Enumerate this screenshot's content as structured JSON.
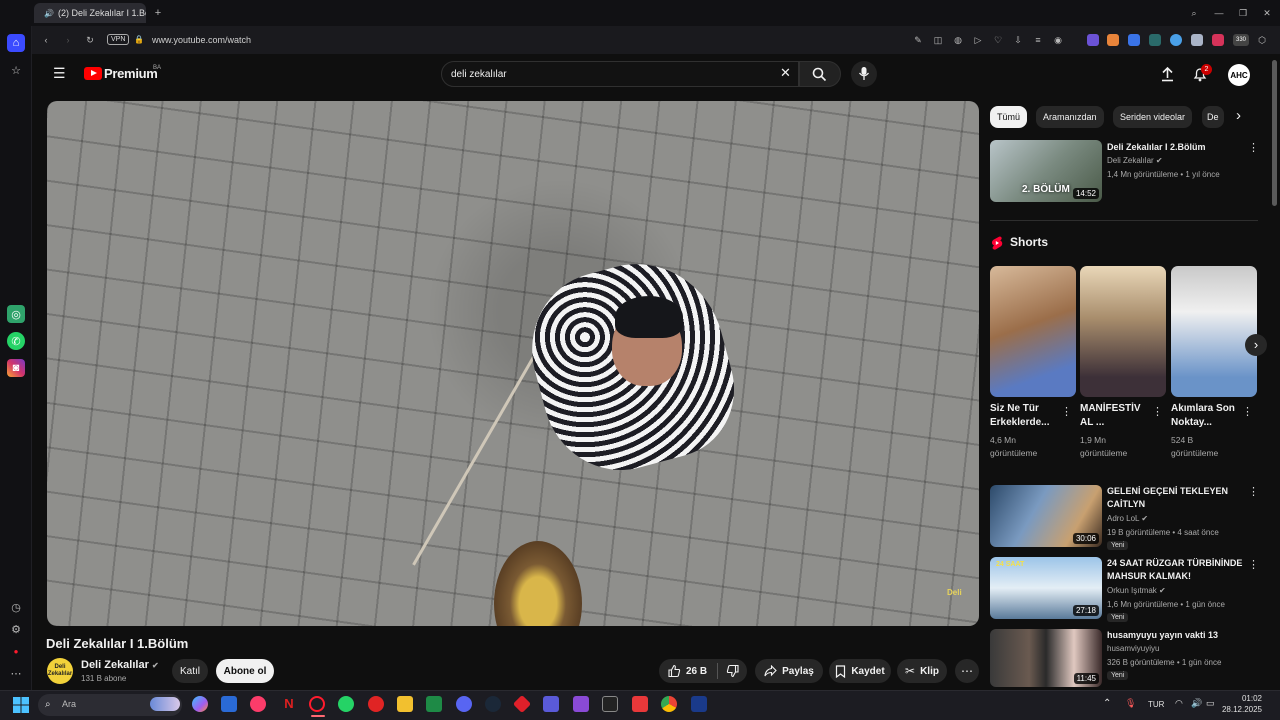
{
  "browser": {
    "tab_title": "(2) Deli Zekalılar I 1.Bölü",
    "url": "www.youtube.com/watch",
    "vpn_label": "VPN",
    "ext_badge": "330"
  },
  "yt": {
    "logo_text": "Premium",
    "region": "BA",
    "search_value": "deli zekalılar",
    "notif_count": "2",
    "avatar_initials": "AHC"
  },
  "video": {
    "title": "Deli Zekalılar I 1.Bölüm",
    "watermark": "Deli",
    "channel": {
      "name": "Deli Zekalılar",
      "subs": "131 B abone",
      "avatar_text": "Deli Zekalılar"
    },
    "actions": {
      "join": "Katıl",
      "subscribe": "Abone ol",
      "likes": "26 B",
      "share": "Paylaş",
      "save": "Kaydet",
      "clip": "Klip"
    }
  },
  "chips": [
    "Tümü",
    "Aramanızdan",
    "Seriden videolar",
    "De"
  ],
  "related_top": {
    "title": "Deli Zekalılar I 2.Bölüm",
    "channel": "Deli Zekalılar",
    "meta": "1,4 Mn görüntüleme • 1 yıl önce",
    "duration": "14:52",
    "thumb_text": "2. BÖLÜM"
  },
  "shorts": {
    "heading": "Shorts",
    "items": [
      {
        "title": "Siz Ne Tür Erkeklerde...",
        "views": "4,6 Mn görüntüleme"
      },
      {
        "title": "MANİFESTİV AL ...",
        "views": "1,9 Mn görüntüleme"
      },
      {
        "title": "Akımlara Son Noktay...",
        "views": "524 B görüntüleme"
      }
    ]
  },
  "related": [
    {
      "title": "GELENİ GEÇENİ TEKLEYEN CAİTLYN",
      "channel": "Adro LoL",
      "meta": "19 B görüntüleme • 4 saat önce",
      "badge": "Yeni",
      "duration": "30:06"
    },
    {
      "title": "24 SAAT RÜZGAR TÜRBİNİNDE MAHSUR KALMAK!",
      "channel": "Orkun Işıtmak",
      "meta": "1,6 Mn görüntüleme • 1 gün önce",
      "badge": "Yeni",
      "duration": "27:18",
      "thumb_text": "24 SAAT"
    },
    {
      "title": "husamyuyu yayın vakti 13",
      "channel": "husamviyuyiyu",
      "meta": "326 B görüntüleme • 1 gün önce",
      "badge": "Yeni",
      "duration": "11:45"
    }
  ],
  "taskbar": {
    "search_placeholder": "Ara",
    "lang": "TUR",
    "time": "01:02",
    "date": "28.12.2025"
  },
  "colors": {
    "yt_red": "#ff0000",
    "background": "#0f0f0f",
    "chip_bg": "#272727",
    "opera_red": "#ff1b2d"
  }
}
